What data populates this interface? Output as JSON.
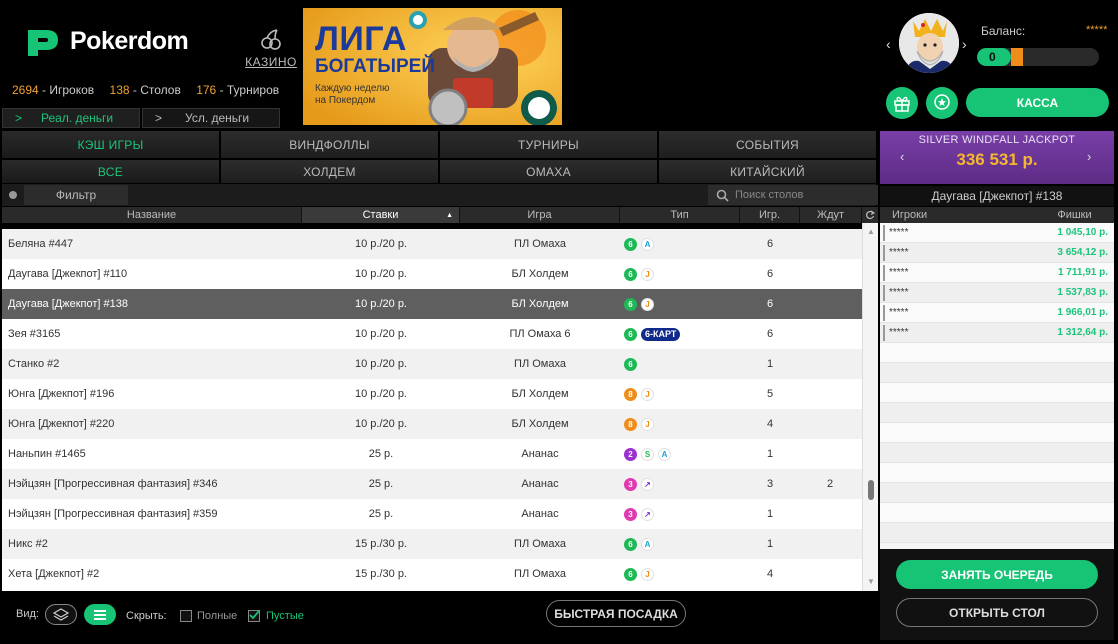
{
  "header": {
    "logo_text": "Pokerdom",
    "casino_label": "КАЗИНО",
    "stats": {
      "players_count": "2694",
      "players_label": "- Игроков",
      "tables_count": "138",
      "tables_label": "- Столов",
      "tournaments_count": "176",
      "tournaments_label": "- Турниров"
    },
    "money_tabs": [
      "Реал. деньги",
      "Усл. деньги"
    ],
    "banner": {
      "title_line1": "ЛИГА",
      "title_line2": "БОГАТЫРЕЙ",
      "subtitle_line1": "Каждую неделю",
      "subtitle_line2": "на Покердом"
    }
  },
  "account": {
    "balance_label": "Баланс:",
    "balance_value": "*****",
    "level": "0",
    "level_progress": 0.28,
    "cashier_label": "КАССА"
  },
  "tabs": {
    "main": [
      "КЭШ ИГРЫ",
      "ВИНДФОЛЛЫ",
      "ТУРНИРЫ",
      "СОБЫТИЯ"
    ],
    "main_active": 0,
    "games": [
      "ВСЕ",
      "ХОЛДЕМ",
      "ОМАХА",
      "КИТАЙСКИЙ"
    ],
    "games_active": 0
  },
  "filter": {
    "button_label": "Фильтр",
    "search_placeholder": "Поиск столов"
  },
  "table": {
    "columns": [
      "Название",
      "Ставки",
      "Игра",
      "Тип",
      "Игр.",
      "Ждут"
    ],
    "rows": [
      {
        "name": "Беляна #447",
        "stakes": "10 р./20 р.",
        "game": "ПЛ Омаха",
        "seats": "6",
        "seats_color": "#1db954",
        "tags": [
          {
            "t": "A",
            "c": "#1aa3d6"
          }
        ],
        "players": "6",
        "waiting": ""
      },
      {
        "name": "Даугава [Джекпот] #110",
        "stakes": "10 р./20 р.",
        "game": "БЛ Холдем",
        "seats": "6",
        "seats_color": "#1db954",
        "tags": [
          {
            "t": "J",
            "c": "#f08c1a"
          }
        ],
        "players": "6",
        "waiting": ""
      },
      {
        "name": "Даугава [Джекпот] #138",
        "stakes": "10 р./20 р.",
        "game": "БЛ Холдем",
        "seats": "6",
        "seats_color": "#1db954",
        "tags": [
          {
            "t": "J",
            "c": "#f08c1a"
          }
        ],
        "players": "6",
        "waiting": "",
        "selected": true
      },
      {
        "name": "Зея #3165",
        "stakes": "10 р./20 р.",
        "game": "ПЛ Омаха 6",
        "seats": "6",
        "seats_color": "#1db954",
        "pill": "6-КАРТ",
        "tags": [],
        "players": "6",
        "waiting": ""
      },
      {
        "name": "Станко #2",
        "stakes": "10 р./20 р.",
        "game": "ПЛ Омаха",
        "seats": "6",
        "seats_color": "#1db954",
        "tags": [],
        "players": "1",
        "waiting": ""
      },
      {
        "name": "Юнга [Джекпот] #196",
        "stakes": "10 р./20 р.",
        "game": "БЛ Холдем",
        "seats": "8",
        "seats_color": "#f08c1a",
        "tags": [
          {
            "t": "J",
            "c": "#f08c1a"
          }
        ],
        "players": "5",
        "waiting": ""
      },
      {
        "name": "Юнга [Джекпот] #220",
        "stakes": "10 р./20 р.",
        "game": "БЛ Холдем",
        "seats": "8",
        "seats_color": "#f08c1a",
        "tags": [
          {
            "t": "J",
            "c": "#f08c1a"
          }
        ],
        "players": "4",
        "waiting": ""
      },
      {
        "name": "Наньпин #1465",
        "stakes": "25 р.",
        "game": "Ананас",
        "seats": "2",
        "seats_color": "#9b2fd0",
        "tags": [
          {
            "t": "S",
            "c": "#1db954"
          },
          {
            "t": "A",
            "c": "#1aa3d6"
          }
        ],
        "players": "1",
        "waiting": ""
      },
      {
        "name": "Нэйцзян [Прогрессивная фантазия] #346",
        "stakes": "25 р.",
        "game": "Ананас",
        "seats": "3",
        "seats_color": "#e03ab0",
        "tags": [
          {
            "t": "↗",
            "c": "#7a2fd0"
          }
        ],
        "players": "3",
        "waiting": "2"
      },
      {
        "name": "Нэйцзян [Прогрессивная фантазия] #359",
        "stakes": "25 р.",
        "game": "Ананас",
        "seats": "3",
        "seats_color": "#e03ab0",
        "tags": [
          {
            "t": "↗",
            "c": "#7a2fd0"
          }
        ],
        "players": "1",
        "waiting": ""
      },
      {
        "name": "Никс #2",
        "stakes": "15 р./30 р.",
        "game": "ПЛ Омаха",
        "seats": "6",
        "seats_color": "#1db954",
        "tags": [
          {
            "t": "A",
            "c": "#1aa3d6"
          }
        ],
        "players": "1",
        "waiting": ""
      },
      {
        "name": "Хета [Джекпот] #2",
        "stakes": "15 р./30 р.",
        "game": "ПЛ Омаха",
        "seats": "6",
        "seats_color": "#1db954",
        "tags": [
          {
            "t": "J",
            "c": "#f08c1a"
          }
        ],
        "players": "4",
        "waiting": ""
      }
    ]
  },
  "bottom": {
    "view_label": "Вид:",
    "hide_label": "Скрыть:",
    "full_label": "Полные",
    "empty_label": "Пустые",
    "empty_checked": true,
    "quick_seat_label": "БЫСТРАЯ ПОСАДКА"
  },
  "jackpot": {
    "title": "SILVER WINDFALL JACKPOT",
    "value": "336 531 р."
  },
  "table_detail": {
    "title": "Даугава [Джекпот] #138",
    "col_players": "Игроки",
    "col_chips": "Фишки",
    "players": [
      {
        "name": "*****",
        "chips": "1 045,10 р."
      },
      {
        "name": "*****",
        "chips": "3 654,12 р."
      },
      {
        "name": "*****",
        "chips": "1 711,91 р."
      },
      {
        "name": "*****",
        "chips": "1 537,83 р."
      },
      {
        "name": "*****",
        "chips": "1 966,01 р."
      },
      {
        "name": "*****",
        "chips": "1 312,64 р."
      }
    ],
    "queue_label": "ЗАНЯТЬ ОЧЕРЕДЬ",
    "open_label": "ОТКРЫТЬ СТОЛ"
  }
}
